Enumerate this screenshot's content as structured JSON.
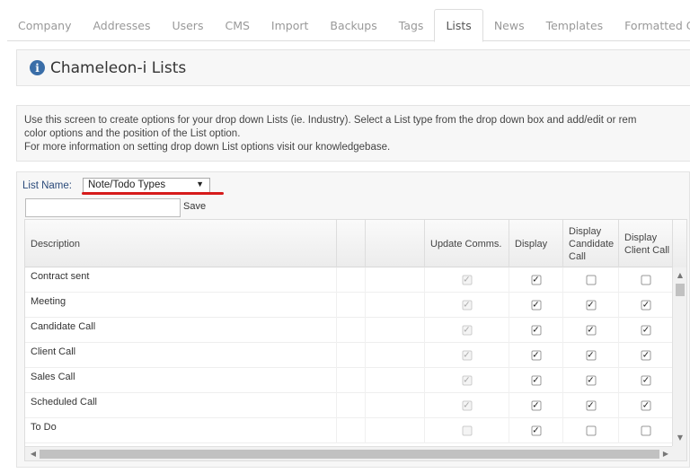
{
  "tabs": [
    {
      "label": "Company",
      "active": false
    },
    {
      "label": "Addresses",
      "active": false
    },
    {
      "label": "Users",
      "active": false
    },
    {
      "label": "CMS",
      "active": false
    },
    {
      "label": "Import",
      "active": false
    },
    {
      "label": "Backups",
      "active": false
    },
    {
      "label": "Tags",
      "active": false
    },
    {
      "label": "Lists",
      "active": true
    },
    {
      "label": "News",
      "active": false
    },
    {
      "label": "Templates",
      "active": false
    },
    {
      "label": "Formatted CVs",
      "active": false
    }
  ],
  "title": {
    "icon": "info-icon",
    "text": "Chameleon-i Lists"
  },
  "help": {
    "line1": "Use this screen to create options for your drop down Lists (ie. Industry). Select a List type from the drop down box and add/edit or rem",
    "line2": "color options and the position of the List option.",
    "line3": "For more information on setting drop down List options visit our knowledgebase."
  },
  "list": {
    "label": "List Name:",
    "selected": "Note/Todo Types",
    "highlight_color": "#d61b1b",
    "save_label": "Save",
    "new_value": ""
  },
  "grid": {
    "columns": [
      {
        "key": "description",
        "label": "Description"
      },
      {
        "key": "blank1",
        "label": ""
      },
      {
        "key": "blank2",
        "label": ""
      },
      {
        "key": "update_comms",
        "label": "Update Comms."
      },
      {
        "key": "display",
        "label": "Display"
      },
      {
        "key": "display_candidate_call",
        "label": "Display Candidate Call"
      },
      {
        "key": "display_client_call",
        "label": "Display Client Call"
      }
    ],
    "rows": [
      {
        "description": "Contract sent",
        "update_comms": true,
        "display": true,
        "display_candidate_call": false,
        "display_client_call": false
      },
      {
        "description": "Meeting",
        "update_comms": true,
        "display": true,
        "display_candidate_call": true,
        "display_client_call": true
      },
      {
        "description": "Candidate Call",
        "update_comms": true,
        "display": true,
        "display_candidate_call": true,
        "display_client_call": true
      },
      {
        "description": "Client Call",
        "update_comms": true,
        "display": true,
        "display_candidate_call": true,
        "display_client_call": true
      },
      {
        "description": "Sales Call",
        "update_comms": true,
        "display": true,
        "display_candidate_call": true,
        "display_client_call": true
      },
      {
        "description": "Scheduled Call",
        "update_comms": true,
        "display": true,
        "display_candidate_call": true,
        "display_client_call": true
      },
      {
        "description": "To Do",
        "update_comms": false,
        "display": true,
        "display_candidate_call": false,
        "display_client_call": false
      }
    ]
  }
}
